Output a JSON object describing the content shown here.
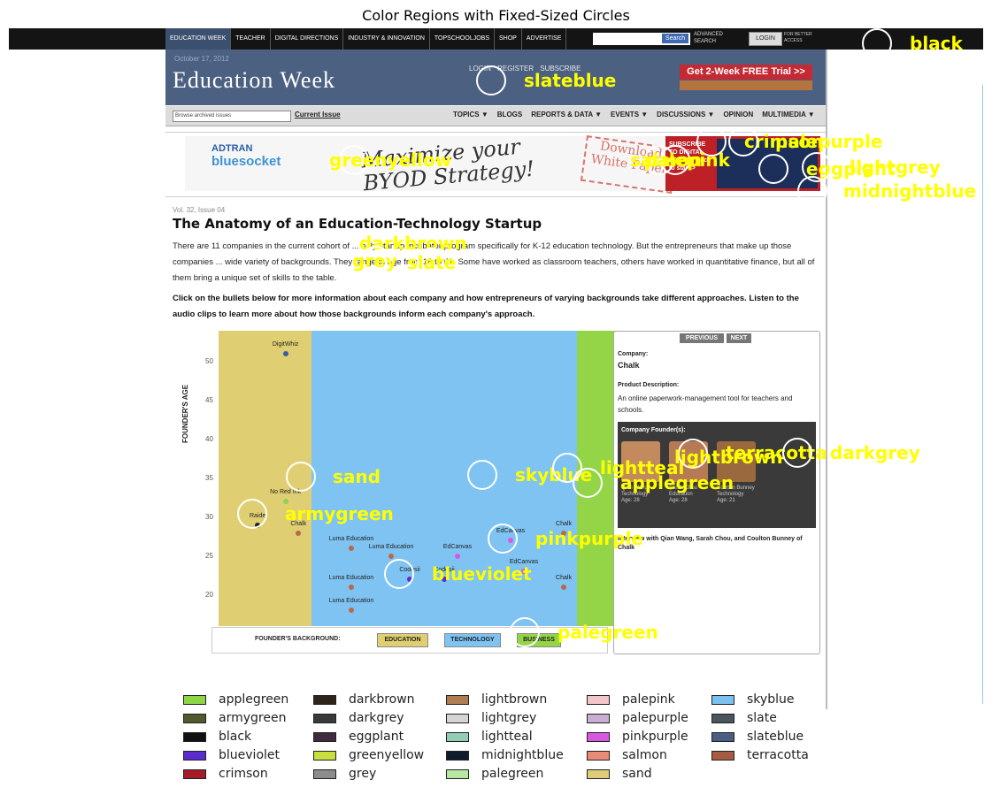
{
  "figure_title": "Color Regions with Fixed-Sized Circles",
  "browser": {
    "nav_tabs": [
      "EDUCATION WEEK",
      "TEACHER",
      "DIGITAL DIRECTIONS",
      "INDUSTRY & INNOVATION",
      "TOPSCHOOLJOBS",
      "SHOP",
      "ADVERTISE"
    ],
    "search_button": "Search",
    "advanced": "ADVANCED SEARCH",
    "login_button": "LOGIN",
    "for_better_access": "FOR BETTER ACCESS"
  },
  "site": {
    "date": "October 17, 2012",
    "logo": "Education Week",
    "top_links": "LOGIN REGISTER SUBSCRIBE",
    "trial_button": "Get 2-Week FREE Trial >>",
    "browse_select": "Browse archived issues",
    "current_issue": "Current Issue",
    "menu": [
      "TOPICS ▼",
      "BLOGS",
      "REPORTS & DATA ▼",
      "EVENTS ▼",
      "DISCUSSIONS ▼",
      "OPINION",
      "MULTIMEDIA ▼"
    ]
  },
  "ad": {
    "brand_top": "ADTRAN",
    "brand_main": "bluesocket",
    "slogan": "Maximize your BYOD Strategy!",
    "download": "Download White Paper",
    "subscribe": "SUBSCRIBE TO DIGITAL EDITION Click to start >"
  },
  "article": {
    "volume": "Vol. 32, Issue 04",
    "title": "The Anatomy of an Education-Technology Startup",
    "intro": "There are 11 companies in the current cohort of ... only startup incubator program specifically for K-12 education technology. But the entrepreneurs that make up those companies ... wide variety of backgrounds. They range in age from 18 to 51. Some have worked as classroom teachers, others have worked in quantitative finance, but all of them bring a unique set of skills to the table.",
    "instructions": "Click on the bullets below for more information about each company and how entrepreneurs of varying backgrounds take different approaches. Listen to the audio clips to learn more about how those backgrounds inform each company's approach."
  },
  "chart_data": {
    "type": "scatter",
    "ylabel": "FOUNDER'S AGE",
    "ylim": [
      16,
      54
    ],
    "yticks": [
      20,
      25,
      30,
      35,
      40,
      45,
      50
    ],
    "background_label": "FOUNDER'S BACKGROUND:",
    "categories": [
      "EDUCATION",
      "TECHNOLOGY",
      "BUSINESS"
    ],
    "category_colors": [
      "#e0cf72",
      "#7ec3f2",
      "#94d548"
    ],
    "points": [
      {
        "label": "DigitWhiz",
        "band": "EDUCATION",
        "x": 0.72,
        "y": 51,
        "color": "#3c5da3"
      },
      {
        "label": "No Red Ink",
        "band": "EDUCATION",
        "x": 0.72,
        "y": 32,
        "color": "#8ed34a"
      },
      {
        "label": "Raide",
        "band": "EDUCATION",
        "x": 0.42,
        "y": 29,
        "color": "#222222"
      },
      {
        "label": "Chalk",
        "band": "EDUCATION",
        "x": 0.86,
        "y": 28,
        "color": "#b86a48"
      },
      {
        "label": "Luma Education",
        "band": "TECHNOLOGY",
        "x": 0.15,
        "y": 26,
        "color": "#b86a48"
      },
      {
        "label": "Luma Education",
        "band": "TECHNOLOGY",
        "x": 0.3,
        "y": 25,
        "color": "#b86a48"
      },
      {
        "label": "EdCanvas",
        "band": "TECHNOLOGY",
        "x": 0.55,
        "y": 25,
        "color": "#d859e0"
      },
      {
        "label": "EdCanvas",
        "band": "TECHNOLOGY",
        "x": 0.75,
        "y": 27,
        "color": "#d859e0"
      },
      {
        "label": "Chalk",
        "band": "TECHNOLOGY",
        "x": 0.95,
        "y": 28,
        "color": "#b86a48"
      },
      {
        "label": "EdCanvas",
        "band": "TECHNOLOGY",
        "x": 0.8,
        "y": 23,
        "color": "#d859e0"
      },
      {
        "label": "Codesii",
        "band": "TECHNOLOGY",
        "x": 0.37,
        "y": 22,
        "color": "#5a2ed0"
      },
      {
        "label": "Codesii",
        "band": "TECHNOLOGY",
        "x": 0.5,
        "y": 22,
        "color": "#5a2ed0"
      },
      {
        "label": "Luma Education",
        "band": "TECHNOLOGY",
        "x": 0.15,
        "y": 21,
        "color": "#b86a48"
      },
      {
        "label": "Chalk",
        "band": "TECHNOLOGY",
        "x": 0.95,
        "y": 21,
        "color": "#b86a48"
      },
      {
        "label": "Luma Education",
        "band": "TECHNOLOGY",
        "x": 0.15,
        "y": 18,
        "color": "#b86a48"
      }
    ]
  },
  "info_panel": {
    "previous": "PREVIOUS",
    "next": "NEXT",
    "company_label": "Company:",
    "company": "Chalk",
    "desc_label": "Product Description:",
    "desc": "An online paperwork-management tool for teachers and schools.",
    "founders_label": "Company Founder(s):",
    "founders": [
      {
        "name": "Qian Wang",
        "field": "Technology",
        "age": "Age: 28"
      },
      {
        "name": "Sarah Chou",
        "field": "Education",
        "age": "Age: 28"
      },
      {
        "name": "Coulton Bunney",
        "field": "Technology",
        "age": "Age: 21"
      }
    ],
    "interview": "Interview with Qian Wang, Sarah Chou, and Coulton Bunney of Chalk"
  },
  "annotations": [
    {
      "label": "black",
      "color": "#111111"
    },
    {
      "label": "slateblue",
      "color": "#4a5d82"
    },
    {
      "label": "greenyellow",
      "color": "#c8df3e"
    },
    {
      "label": "crimson",
      "color": "#a51c26"
    },
    {
      "label": "palepurple",
      "color": "#c9aed1"
    },
    {
      "label": "salmon",
      "color": "#e98a76"
    },
    {
      "label": "palepink",
      "color": "#f2c6c8"
    },
    {
      "label": "eggplant",
      "color": "#3f2b3d"
    },
    {
      "label": "lightgrey",
      "color": "#d4d4d4"
    },
    {
      "label": "midnightblue",
      "color": "#0e1c2c"
    },
    {
      "label": "darkbrown",
      "color": "#2e241a"
    },
    {
      "label": "grey",
      "color": "#8c8c8c"
    },
    {
      "label": "slate",
      "color": "#4c555e"
    },
    {
      "label": "sand",
      "color": "#dfcc79"
    },
    {
      "label": "skyblue",
      "color": "#7bc1ef"
    },
    {
      "label": "lightteal",
      "color": "#93cdb5"
    },
    {
      "label": "lightbrown",
      "color": "#b07c51"
    },
    {
      "label": "terracotta",
      "color": "#a75b43"
    },
    {
      "label": "darkgrey",
      "color": "#39393c"
    },
    {
      "label": "applegreen",
      "color": "#8ed447"
    },
    {
      "label": "armygreen",
      "color": "#4f5a2d"
    },
    {
      "label": "pinkpurple",
      "color": "#d657e0"
    },
    {
      "label": "blueviolet",
      "color": "#5a2ccb"
    },
    {
      "label": "palegreen",
      "color": "#b7e8a2"
    }
  ],
  "legend": [
    {
      "label": "applegreen",
      "color": "#8ed447"
    },
    {
      "label": "armygreen",
      "color": "#4f5a2d"
    },
    {
      "label": "black",
      "color": "#111111"
    },
    {
      "label": "blueviolet",
      "color": "#5a2ccb"
    },
    {
      "label": "crimson",
      "color": "#a51c26"
    },
    {
      "label": "darkbrown",
      "color": "#2e241a"
    },
    {
      "label": "darkgrey",
      "color": "#39393c"
    },
    {
      "label": "eggplant",
      "color": "#3f2b3d"
    },
    {
      "label": "greenyellow",
      "color": "#c8df3e"
    },
    {
      "label": "grey",
      "color": "#8c8c8c"
    },
    {
      "label": "lightbrown",
      "color": "#b07c51"
    },
    {
      "label": "lightgrey",
      "color": "#d4d4d4"
    },
    {
      "label": "lightteal",
      "color": "#93cdb5"
    },
    {
      "label": "midnightblue",
      "color": "#0e1c2c"
    },
    {
      "label": "palegreen",
      "color": "#b7e8a2"
    },
    {
      "label": "palepink",
      "color": "#f2c6c8"
    },
    {
      "label": "palepurple",
      "color": "#c9aed1"
    },
    {
      "label": "pinkpurple",
      "color": "#d657e0"
    },
    {
      "label": "salmon",
      "color": "#e98a76"
    },
    {
      "label": "sand",
      "color": "#dfcc79"
    },
    {
      "label": "skyblue",
      "color": "#7bc1ef"
    },
    {
      "label": "slate",
      "color": "#4c555e"
    },
    {
      "label": "slateblue",
      "color": "#4a5d82"
    },
    {
      "label": "terracotta",
      "color": "#a75b43"
    }
  ]
}
